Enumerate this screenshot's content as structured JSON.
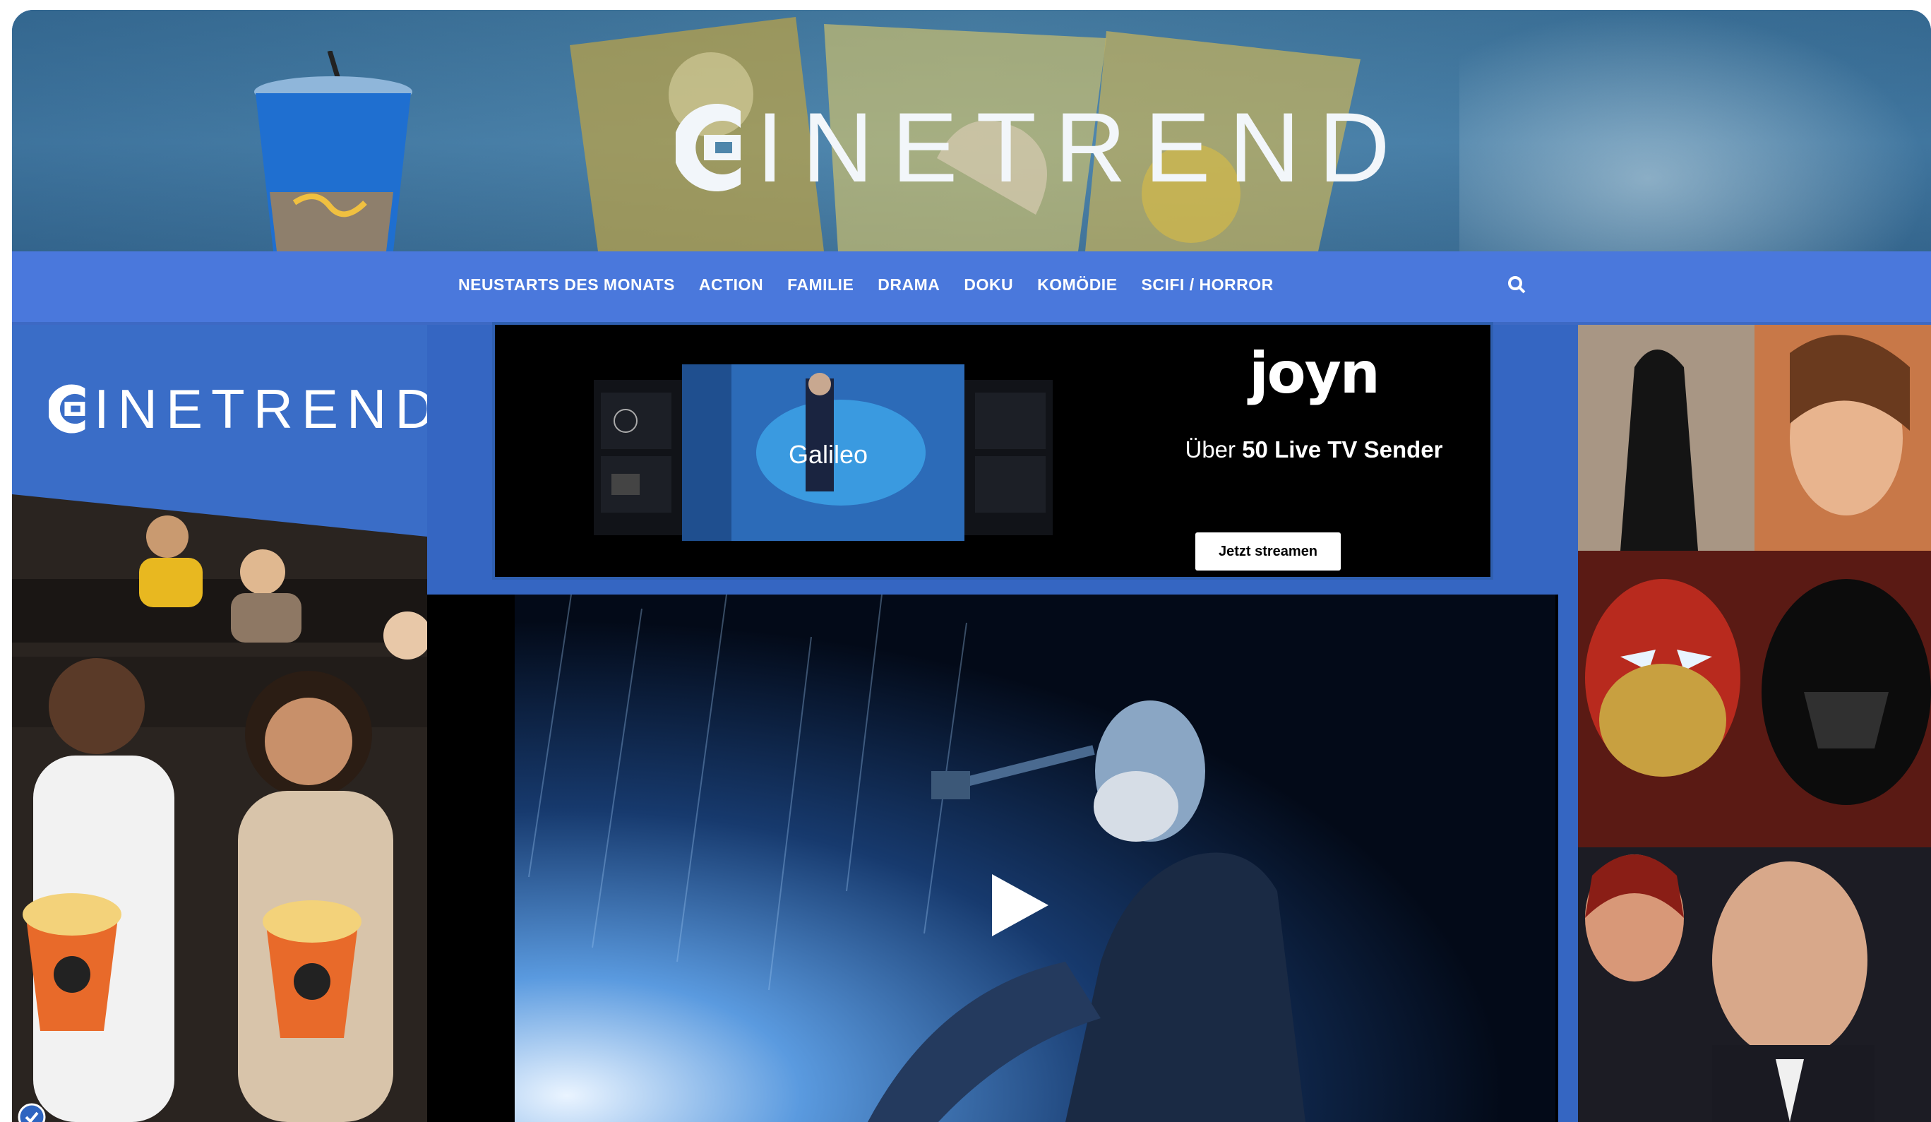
{
  "header": {
    "logo_text": "INETREND"
  },
  "nav": {
    "items": [
      {
        "label": "Neustarts des Monats"
      },
      {
        "label": "Action"
      },
      {
        "label": "Familie"
      },
      {
        "label": "Drama"
      },
      {
        "label": "Doku"
      },
      {
        "label": "Komödie"
      },
      {
        "label": "SciFi / Horror"
      }
    ],
    "search_icon": "search-icon"
  },
  "left_panel": {
    "logo_text": "INETREND"
  },
  "ad": {
    "brand": "joyn",
    "tagline_prefix": "Über ",
    "tagline_bold": "50 Live TV Sender",
    "cta_label": "Jetzt streamen",
    "mockup_show": "Galileo"
  },
  "video": {
    "play_icon": "play-icon"
  },
  "colors": {
    "nav_bg": "#4a78dc",
    "panel_bg": "#3a6dc7",
    "ad_bg": "#000000"
  }
}
